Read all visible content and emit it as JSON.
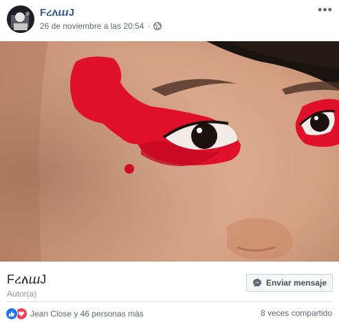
{
  "post": {
    "page_name": "FረለⴍJ",
    "timestamp": "26 de noviembre a las 20:54",
    "separator": "·",
    "privacy_icon": "globe-icon",
    "more_label": "•••"
  },
  "footer": {
    "author_name": "FረለⴍJ",
    "author_role": "Autor(a)",
    "message_button": "Enviar mensaje",
    "message_icon": "messenger-icon",
    "reactions_text": "Jean Close y 46 personas más",
    "shares_text": "8 veces compartido"
  },
  "colors": {
    "link_blue": "#385898",
    "like_blue": "#1877f2",
    "love_red": "#f33e58",
    "paint_red": "#e0102a"
  }
}
